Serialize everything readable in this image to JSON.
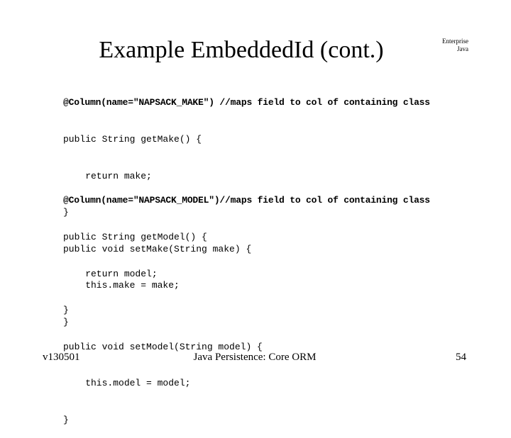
{
  "slide": {
    "title": "Example EmbeddedId (cont.)",
    "corner_label": {
      "line1": "Enterprise",
      "line2": "Java"
    },
    "code_blocks": [
      {
        "lines": [
          "@Column(name=\"NAPSACK_MAKE\") //maps field to col of containing class",
          "public String getMake() {",
          "    return make;",
          "}",
          "public void setMake(String make) {",
          "    this.make = make;",
          "}"
        ]
      },
      {
        "lines": [
          "@Column(name=\"NAPSACK_MODEL\")//maps field to col of containing class",
          "public String getModel() {",
          "    return model;",
          "}",
          "public void setModel(String model) {",
          "    this.model = model;",
          "}"
        ]
      }
    ],
    "footer": {
      "version": "v130501",
      "course_title": "Java Persistence: Core ORM",
      "page_number": "54"
    }
  }
}
